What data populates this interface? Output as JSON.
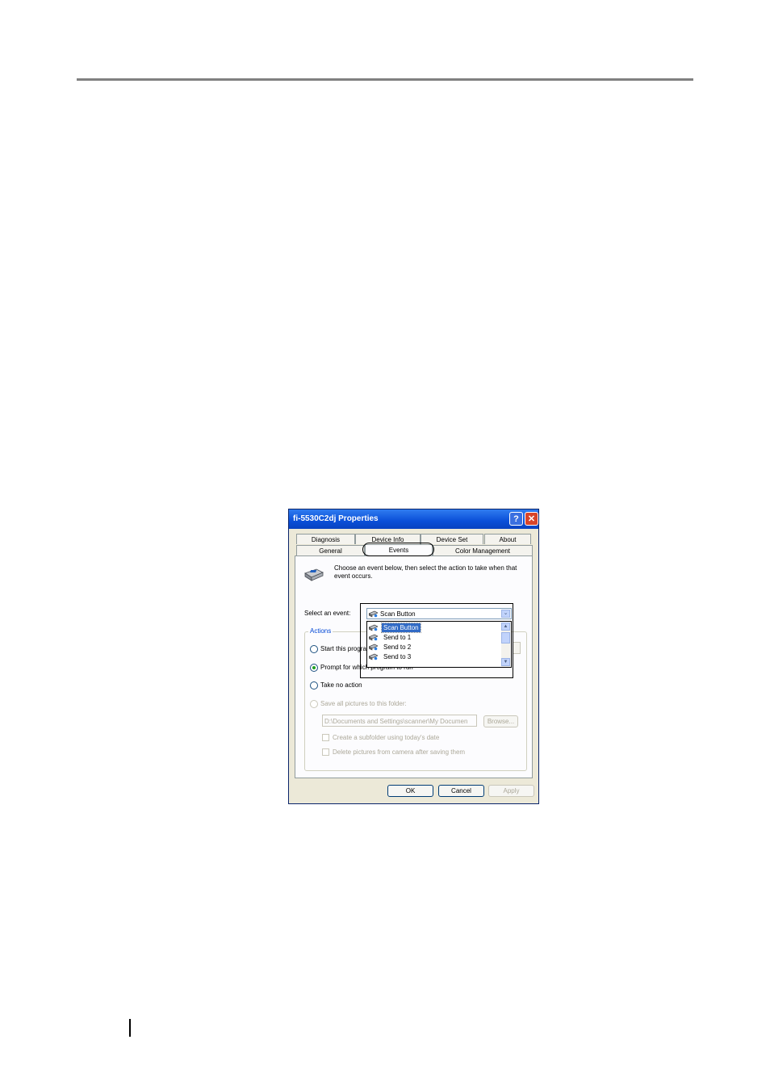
{
  "dialog": {
    "title": "fi-5530C2dj Properties",
    "help_glyph": "?",
    "close_glyph": "✕"
  },
  "tabs": {
    "row1": [
      "Diagnosis",
      "Device Info",
      "Device Set",
      "About"
    ],
    "row2": [
      "General",
      "Events",
      "Color Management"
    ],
    "selected": "Events"
  },
  "events_panel": {
    "description_line1": "Choose an event below, then select the action to take when that",
    "description_line2": "event occurs.",
    "select_label": "Select an event:",
    "selected_event": "Scan Button",
    "event_list": [
      "Scan Button",
      "Send to 1",
      "Send to 2",
      "Send to 3"
    ],
    "combo_arrow": "⌄",
    "scroll_up": "▲",
    "scroll_down": "▼"
  },
  "actions": {
    "legend": "Actions",
    "start_program": "Start this program",
    "prompt_program": "Prompt for which program to run",
    "take_no_action": "Take no action",
    "save_pictures": "Save all pictures to this folder:",
    "folder_path": "D:\\Documents and Settings\\scanner\\My Documen",
    "browse": "Browse...",
    "create_subfolder": "Create a subfolder using today's date",
    "delete_pictures": "Delete pictures from camera after saving them",
    "selected_action": "prompt_program"
  },
  "buttons": {
    "ok": "OK",
    "cancel": "Cancel",
    "apply": "Apply"
  }
}
